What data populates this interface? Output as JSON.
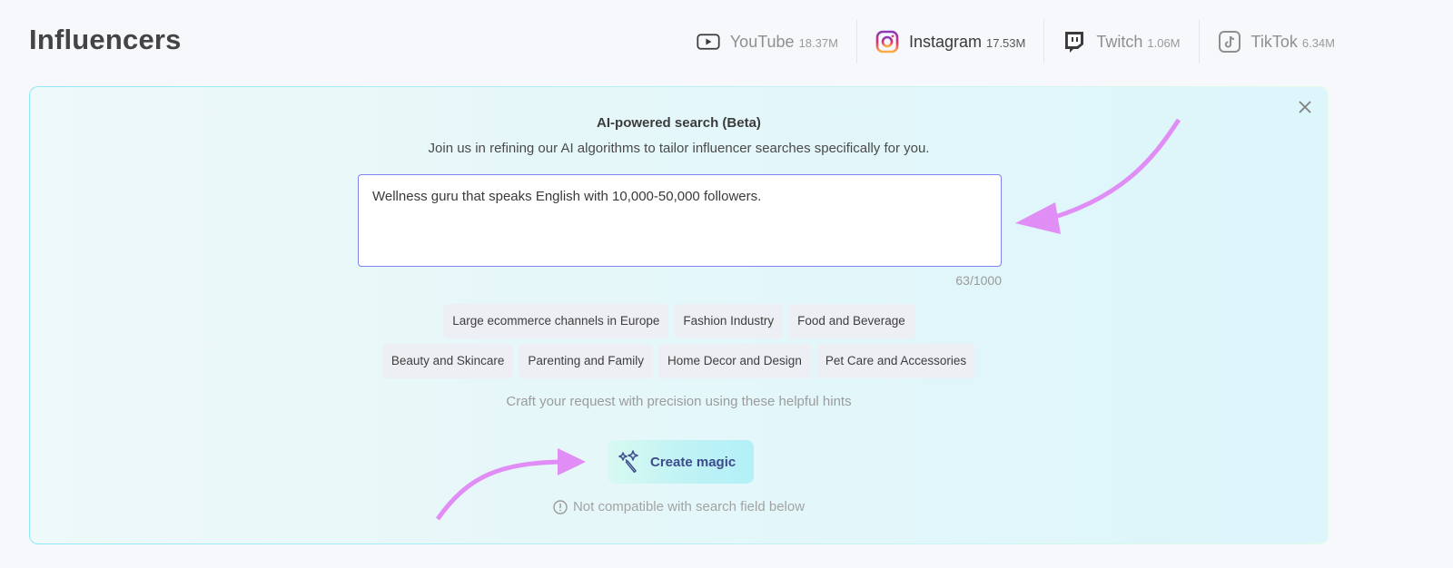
{
  "header": {
    "title": "Influencers"
  },
  "platforms": [
    {
      "name": "YouTube",
      "count": "18.37M",
      "icon": "youtube-icon",
      "active": false
    },
    {
      "name": "Instagram",
      "count": "17.53M",
      "icon": "instagram-icon",
      "active": true
    },
    {
      "name": "Twitch",
      "count": "1.06M",
      "icon": "twitch-icon",
      "active": false
    },
    {
      "name": "TikTok",
      "count": "6.34M",
      "icon": "tiktok-icon",
      "active": false
    }
  ],
  "ai_search": {
    "title": "AI-powered search (Beta)",
    "subtitle": "Join us in refining our AI algorithms to tailor influencer searches specifically for you.",
    "prompt_value": "Wellness guru that speaks English with 10,000-50,000 followers.",
    "char_count": "63/1000",
    "hints_row1": [
      "Large ecommerce channels in Europe",
      "Fashion Industry",
      "Food and Beverage"
    ],
    "hints_row2": [
      "Beauty and Skincare",
      "Parenting and Family",
      "Home Decor and Design",
      "Pet Care and Accessories"
    ],
    "hint_caption": "Craft your request with precision using these helpful hints",
    "create_button": "Create magic",
    "warning": "Not compatible with search field below",
    "close_icon": "close-icon"
  },
  "colors": {
    "accent_border": "#7f84f2",
    "annotation_arrow": "#e08ef5",
    "button_text": "#3d4a8c",
    "instagram_gradient": [
      "#833ab4",
      "#fd1d1d",
      "#fcb045"
    ]
  }
}
